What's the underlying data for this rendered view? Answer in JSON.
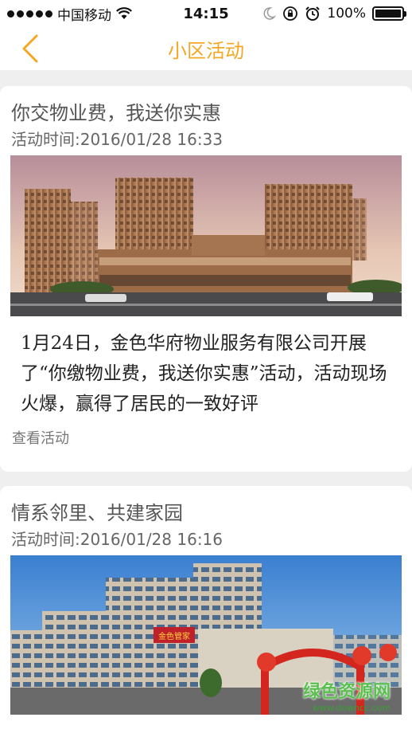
{
  "status_bar": {
    "carrier": "中国移动",
    "time": "14:15",
    "battery": "100%",
    "battery_level": 1.0
  },
  "nav": {
    "title": "小区活动",
    "back_icon": "chevron-left-icon",
    "accent_color": "#f5a623"
  },
  "activities": [
    {
      "title": "你交物业费，我送你实惠",
      "time": "活动时间:2016/01/28 16:33",
      "description": "1月24日，金色华府物业服务有限公司开展了“你缴物业费，我送你实惠”活动，活动现场火爆，赢得了居民的一致好评",
      "link": "查看活动"
    },
    {
      "title": "情系邻里、共建家园",
      "time": "活动时间:2016/01/28 16:16",
      "image_sign": "金色管家",
      "watermark": "绿色资源网",
      "watermark_url": "www.downcc.com"
    }
  ]
}
